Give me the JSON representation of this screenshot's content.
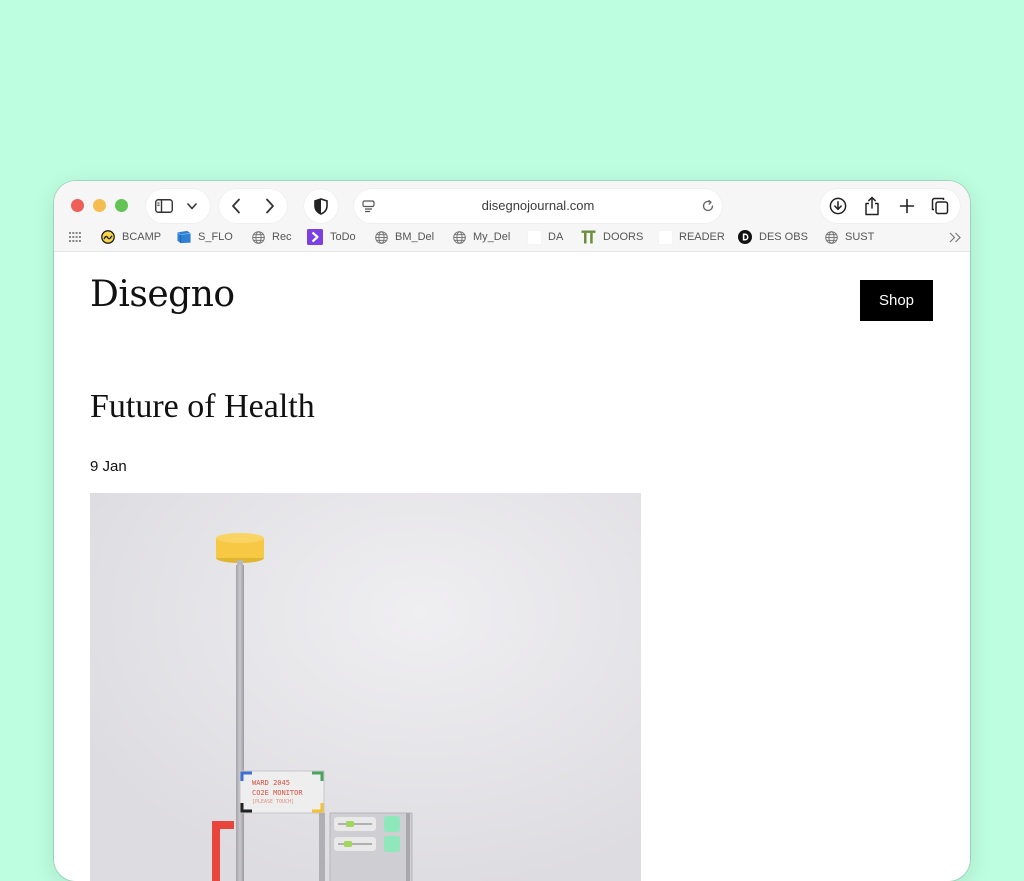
{
  "browser": {
    "url": "disegnojournal.com",
    "bookmarks": [
      {
        "label": "BCAMP",
        "icon": "basecamp-icon"
      },
      {
        "label": "S_FLO",
        "icon": "folder-icon"
      },
      {
        "label": "Rec",
        "icon": "globe-icon"
      },
      {
        "label": "ToDo",
        "icon": "todo-icon"
      },
      {
        "label": "BM_Del",
        "icon": "globe-icon"
      },
      {
        "label": "My_Del",
        "icon": "globe-icon"
      },
      {
        "label": "DA",
        "icon": "blank-icon"
      },
      {
        "label": "DOORS",
        "icon": "doors-icon"
      },
      {
        "label": "READER",
        "icon": "blank-icon"
      },
      {
        "label": "DES OBS",
        "icon": "des-obs-icon"
      },
      {
        "label": "SUST",
        "icon": "globe-icon"
      }
    ]
  },
  "site": {
    "logo": "Disegno",
    "shop_label": "Shop"
  },
  "article": {
    "title": "Future of Health",
    "date": "9 Jan",
    "image_sign": {
      "line1": "WARD 2045",
      "line2": "CO2E MONITOR",
      "line3": "[PLEASE TOUCH]"
    }
  },
  "colors": {
    "background": "#bdfde0",
    "lamp": "#f6c843",
    "sign_text": "#d9503e",
    "shop_bg": "#000000"
  }
}
